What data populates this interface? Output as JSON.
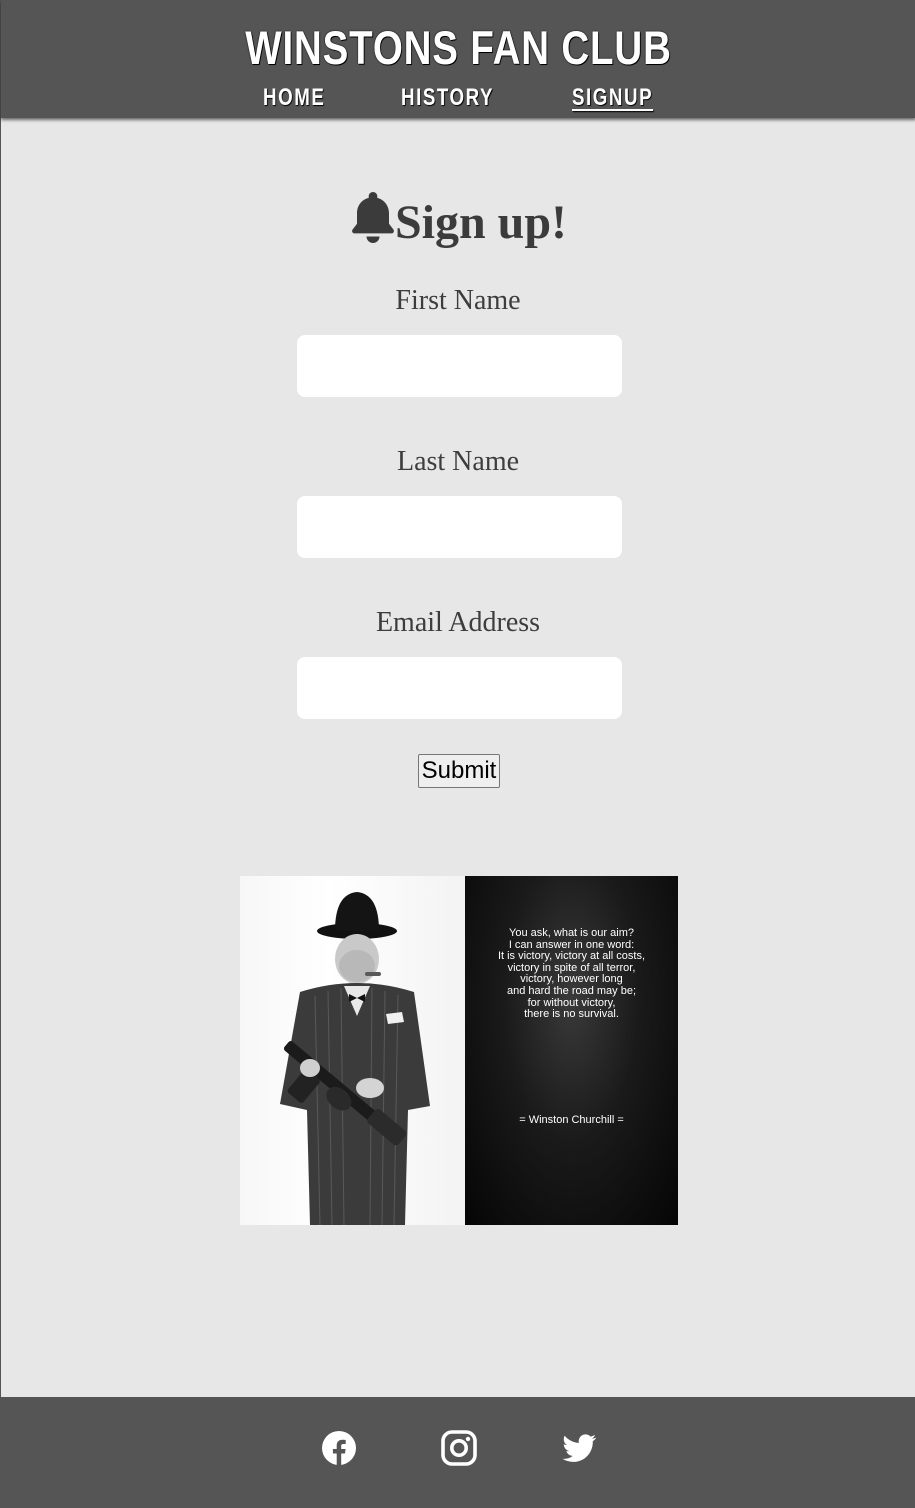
{
  "header": {
    "site_title": "WINSTONS FAN CLUB",
    "nav": {
      "home": "HOME",
      "history": "HISTORY",
      "signup": "SIGNUP"
    },
    "active_nav": "signup"
  },
  "form": {
    "heading_icon": "bell-icon",
    "heading": "Sign up!",
    "fields": [
      {
        "label": "First Name",
        "value": ""
      },
      {
        "label": "Last Name",
        "value": ""
      },
      {
        "label": "Email Address",
        "value": ""
      }
    ],
    "submit_label": "Submit"
  },
  "poster": {
    "quote_lines": [
      "You ask, what is our aim?",
      "I can answer in one word:",
      "It is victory, victory at all costs,",
      "victory in spite of all terror,",
      "victory, however long",
      "and hard the road may be;",
      "for without victory,",
      "there is no survival."
    ],
    "attribution": "= Winston Churchill ="
  },
  "footer": {
    "social_icons": [
      "facebook-icon",
      "instagram-icon",
      "twitter-icon"
    ]
  },
  "colors": {
    "header_bg": "#555555",
    "page_bg": "#e7e7e7",
    "text": "#3b3b3b",
    "input_bg": "#ffffff"
  }
}
